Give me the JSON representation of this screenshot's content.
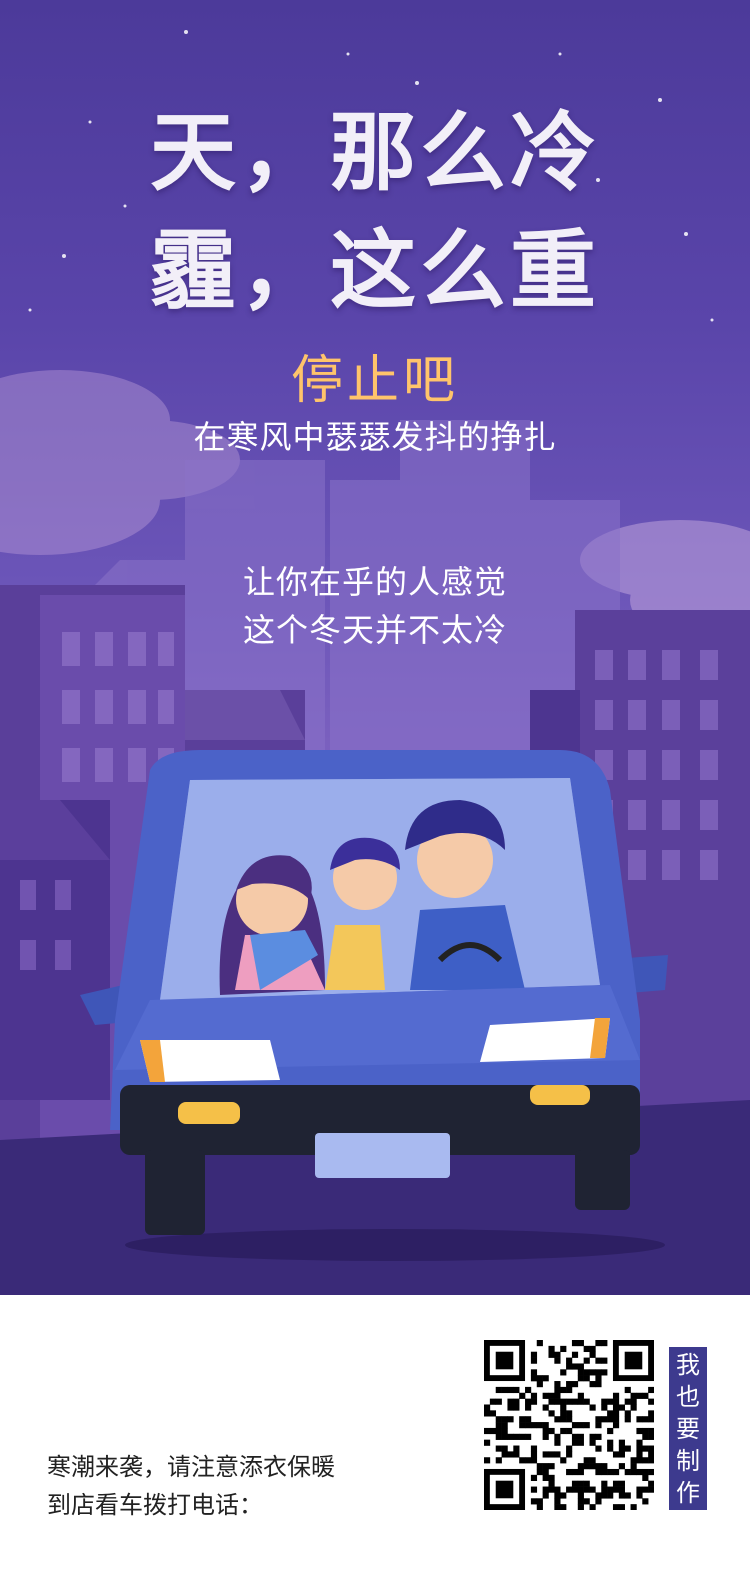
{
  "poster": {
    "title_line1": "天，那么冷",
    "title_line2": "霾，这么重",
    "subtitle": "停止吧",
    "subtitle2": "在寒风中瑟瑟发抖的挣扎",
    "message_line1": "让你在乎的人感觉",
    "message_line2": "这个冬天并不太冷",
    "colors": {
      "sky_top": "#4c3a9a",
      "accent_yellow": "#ffc46b",
      "car_blue": "#4b62c8",
      "button_bg": "#3d3a8e"
    }
  },
  "footer": {
    "line1": "寒潮来袭，请注意添衣保暖",
    "line2": "到店看车拨打电话：",
    "qr_icon": "qr-code-icon",
    "make_button": [
      "我",
      "也",
      "要",
      "制",
      "作"
    ]
  }
}
